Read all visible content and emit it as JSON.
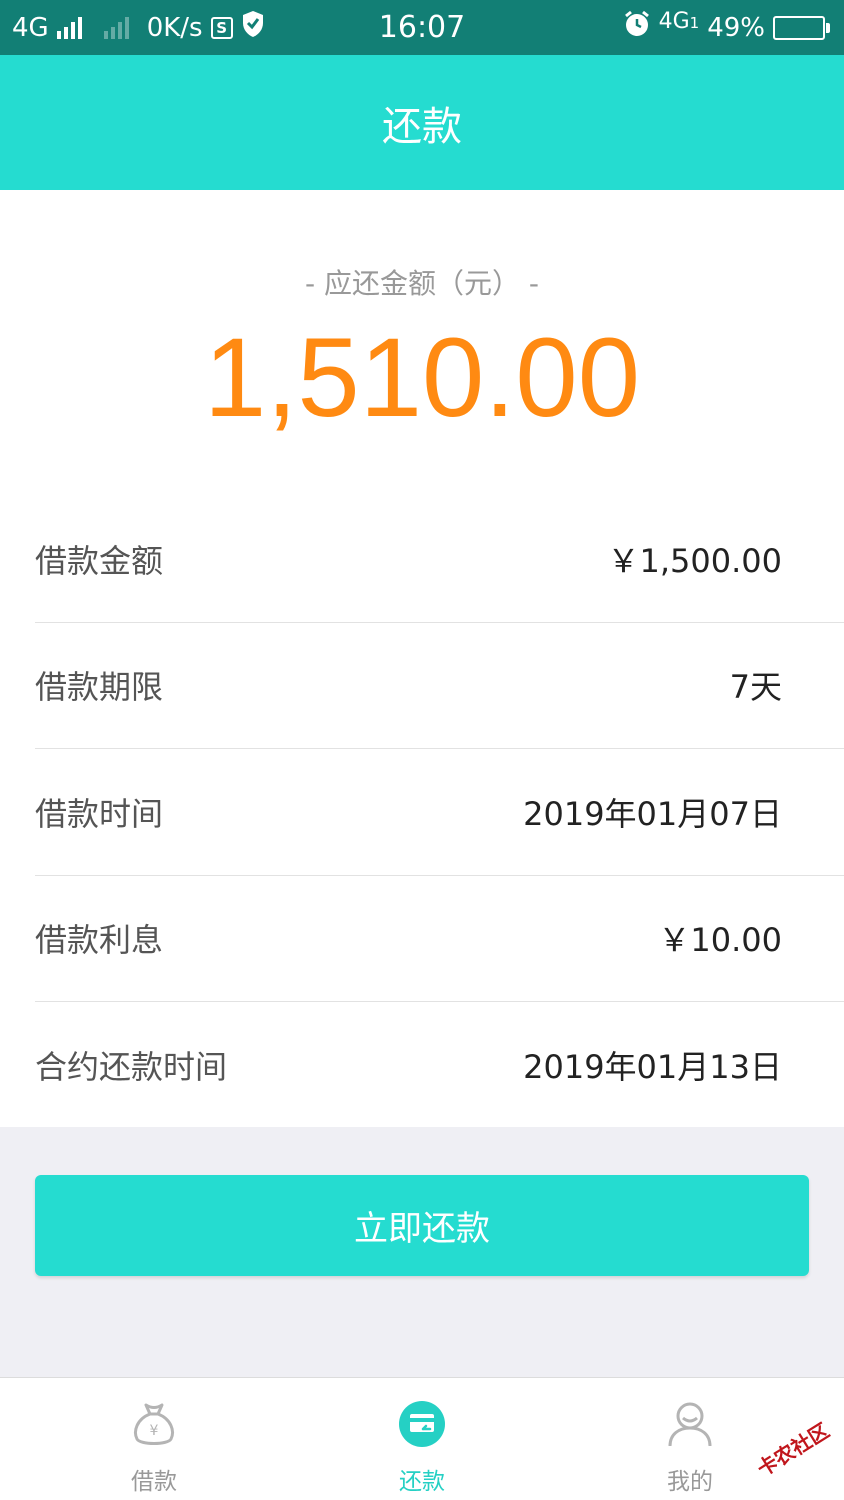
{
  "status_bar": {
    "network": "4G",
    "speed": "0K/s",
    "time": "16:07",
    "network2": "4G",
    "network2_sub": "1",
    "battery": "49%",
    "battery_level": 0.49
  },
  "header": {
    "title": "还款"
  },
  "summary": {
    "label": "- 应还金额（元） -",
    "amount": "1,510.00",
    "amount_color": "#ff8a12"
  },
  "details": [
    {
      "label": "借款金额",
      "value": "￥1,500.00"
    },
    {
      "label": "借款期限",
      "value": "7天"
    },
    {
      "label": "借款时间",
      "value": "2019年01月07日"
    },
    {
      "label": "借款利息",
      "value": "￥10.00"
    },
    {
      "label": "合约还款时间",
      "value": "2019年01月13日"
    }
  ],
  "repay_button": {
    "label": "立即还款"
  },
  "nav": [
    {
      "label": "借款",
      "icon": "money-bag-icon",
      "active": false
    },
    {
      "label": "还款",
      "icon": "repay-card-icon",
      "active": true
    },
    {
      "label": "我的",
      "icon": "user-icon",
      "active": false
    }
  ],
  "watermark": {
    "text": "卡农社区"
  },
  "colors": {
    "accent": "#25dcd0",
    "status_bar": "#127f75",
    "amount": "#ff8a12"
  }
}
